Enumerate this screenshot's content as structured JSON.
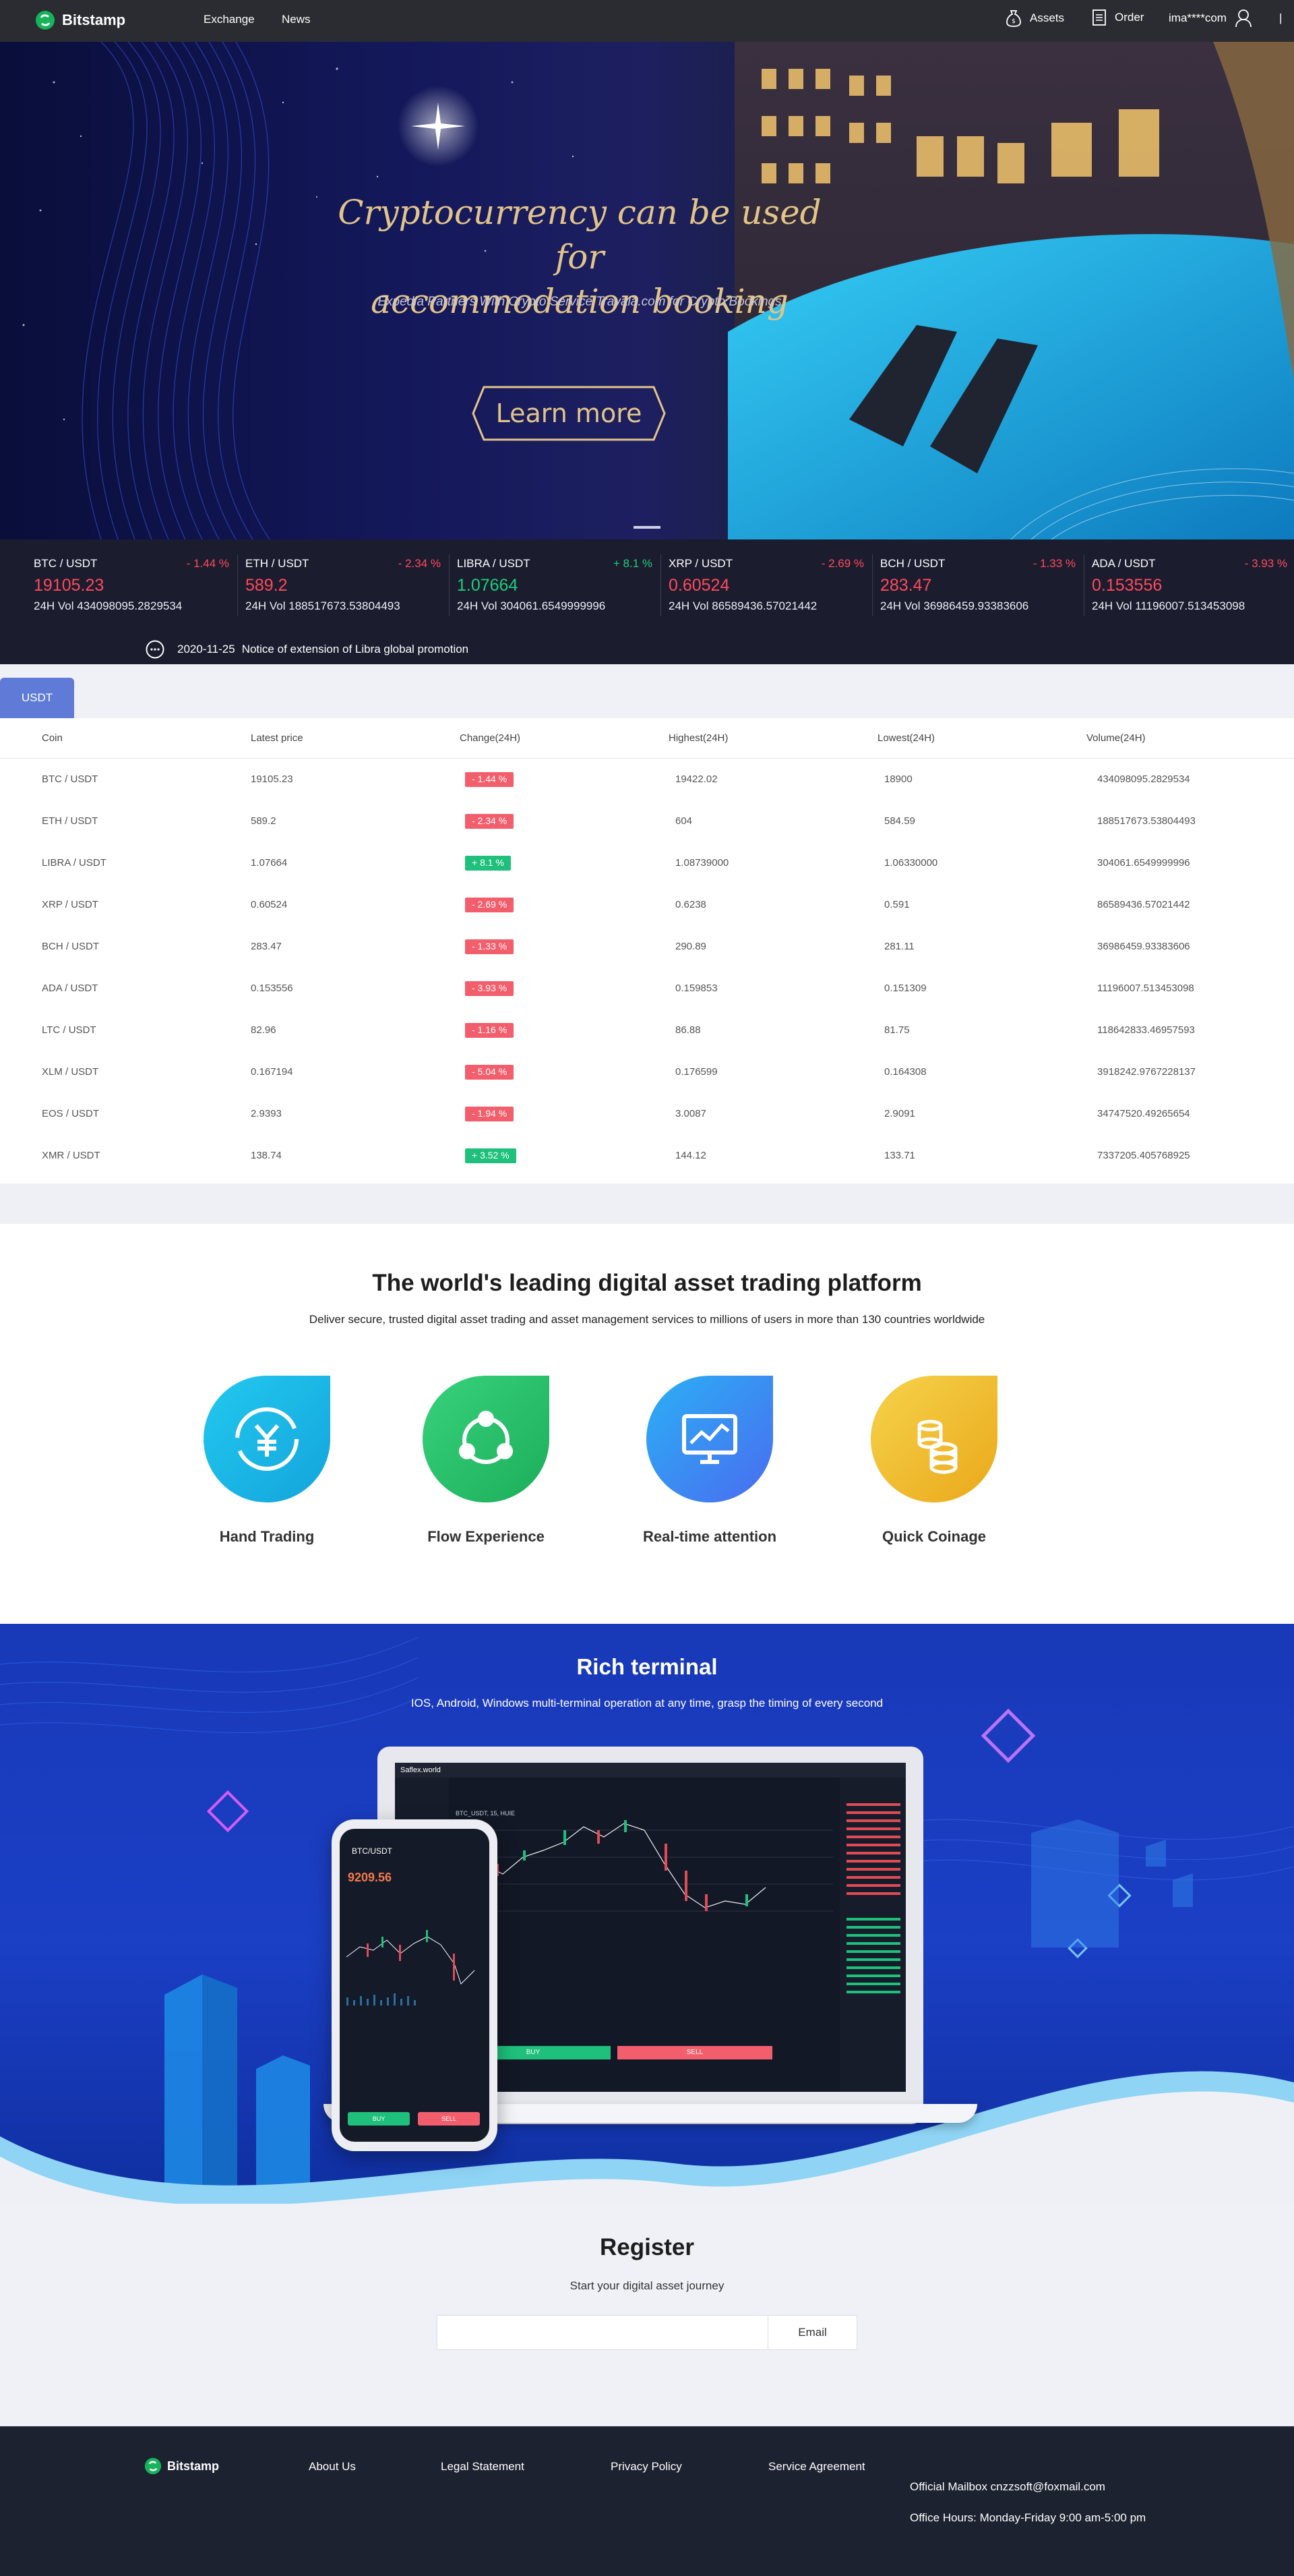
{
  "header": {
    "brand": "Bitstamp",
    "nav": [
      "Exchange",
      "News"
    ],
    "assets_label": "Assets",
    "order_label": "Order",
    "user_label": "ima****com",
    "divider": "|"
  },
  "banner": {
    "title_line1": "Cryptocurrency can be used for",
    "title_line2": "accommodation booking",
    "subtitle": "Expedia Partners With Crypto Service Travala.com for Crypto Bookings",
    "button_label": "Learn more"
  },
  "ticker": [
    {
      "pair": "BTC / USDT",
      "change": "- 1.44 %",
      "price": "19105.23",
      "volume": "24H Vol 434098095.2829534",
      "dir": "down"
    },
    {
      "pair": "ETH / USDT",
      "change": "- 2.34 %",
      "price": "589.2",
      "volume": "24H Vol 188517673.53804493",
      "dir": "down"
    },
    {
      "pair": "LIBRA / USDT",
      "change": "+ 8.1 %",
      "price": "1.07664",
      "volume": "24H Vol 304061.6549999996",
      "dir": "up"
    },
    {
      "pair": "XRP / USDT",
      "change": "- 2.69 %",
      "price": "0.60524",
      "volume": "24H Vol 86589436.57021442",
      "dir": "down"
    },
    {
      "pair": "BCH / USDT",
      "change": "- 1.33 %",
      "price": "283.47",
      "volume": "24H Vol 36986459.93383606",
      "dir": "down"
    },
    {
      "pair": "ADA / USDT",
      "change": "- 3.93 %",
      "price": "0.153556",
      "volume": "24H Vol 11196007.513453098",
      "dir": "down"
    }
  ],
  "notice": {
    "date": "2020-11-25",
    "text": "Notice of extension of Libra global promotion"
  },
  "market": {
    "tab": "USDT",
    "columns": [
      "Coin",
      "Latest price",
      "Change(24H)",
      "Highest(24H)",
      "Lowest(24H)",
      "Volume(24H)"
    ],
    "rows": [
      {
        "coin": "BTC / USDT",
        "price": "19105.23",
        "change": "- 1.44 %",
        "dir": "down",
        "high": "19422.02",
        "low": "18900",
        "volume": "434098095.2829534"
      },
      {
        "coin": "ETH / USDT",
        "price": "589.2",
        "change": "- 2.34 %",
        "dir": "down",
        "high": "604",
        "low": "584.59",
        "volume": "188517673.53804493"
      },
      {
        "coin": "LIBRA / USDT",
        "price": "1.07664",
        "change": "+ 8.1 %",
        "dir": "up",
        "high": "1.08739000",
        "low": "1.06330000",
        "volume": "304061.6549999996"
      },
      {
        "coin": "XRP / USDT",
        "price": "0.60524",
        "change": "- 2.69 %",
        "dir": "down",
        "high": "0.6238",
        "low": "0.591",
        "volume": "86589436.57021442"
      },
      {
        "coin": "BCH / USDT",
        "price": "283.47",
        "change": "- 1.33 %",
        "dir": "down",
        "high": "290.89",
        "low": "281.11",
        "volume": "36986459.93383606"
      },
      {
        "coin": "ADA / USDT",
        "price": "0.153556",
        "change": "- 3.93 %",
        "dir": "down",
        "high": "0.159853",
        "low": "0.151309",
        "volume": "11196007.513453098"
      },
      {
        "coin": "LTC / USDT",
        "price": "82.96",
        "change": "- 1.16 %",
        "dir": "down",
        "high": "86.88",
        "low": "81.75",
        "volume": "118642833.46957593"
      },
      {
        "coin": "XLM / USDT",
        "price": "0.167194",
        "change": "- 5.04 %",
        "dir": "down",
        "high": "0.176599",
        "low": "0.164308",
        "volume": "3918242.9767228137"
      },
      {
        "coin": "EOS / USDT",
        "price": "2.9393",
        "change": "- 1.94 %",
        "dir": "down",
        "high": "3.0087",
        "low": "2.9091",
        "volume": "34747520.49265654"
      },
      {
        "coin": "XMR / USDT",
        "price": "138.74",
        "change": "+ 3.52 %",
        "dir": "up",
        "high": "144.12",
        "low": "133.71",
        "volume": "7337205.405768925"
      }
    ]
  },
  "features": {
    "title": "The world's leading digital asset trading platform",
    "subtitle": "Deliver secure, trusted digital asset trading and asset management services to millions of users in more than 130 countries worldwide",
    "items": [
      {
        "label": "Hand Trading",
        "icon": "yen-exchange-icon",
        "color": "#1cb5e6"
      },
      {
        "label": "Flow Experience",
        "icon": "network-nodes-icon",
        "color": "#27c06a"
      },
      {
        "label": "Real-time attention",
        "icon": "monitor-chart-icon",
        "color": "#3a8af0"
      },
      {
        "label": "Quick Coinage",
        "icon": "coin-stack-icon",
        "color": "#f0b81f"
      }
    ]
  },
  "terminal": {
    "title": "Rich terminal",
    "subtitle": "IOS, Android, Windows multi-terminal operation at any time, grasp the timing of every second",
    "laptop_brand": "Saflex.world",
    "laptop_pair": "BTC_USDT, 15, HUIE",
    "phone_pair": "BTC/USDT",
    "phone_price": "9209.56",
    "buy_label": "BUY",
    "sell_label": "SELL"
  },
  "register": {
    "title": "Register",
    "subtitle": "Start your digital asset journey",
    "button_label": "Email"
  },
  "footer": {
    "brand": "Bitstamp",
    "links": [
      "About Us",
      "Legal Statement",
      "Privacy Policy",
      "Service Agreement"
    ],
    "mailbox": "Official Mailbox cnzzsoft@foxmail.com",
    "hours": "Office Hours: Monday-Friday 9:00 am-5:00 pm"
  }
}
